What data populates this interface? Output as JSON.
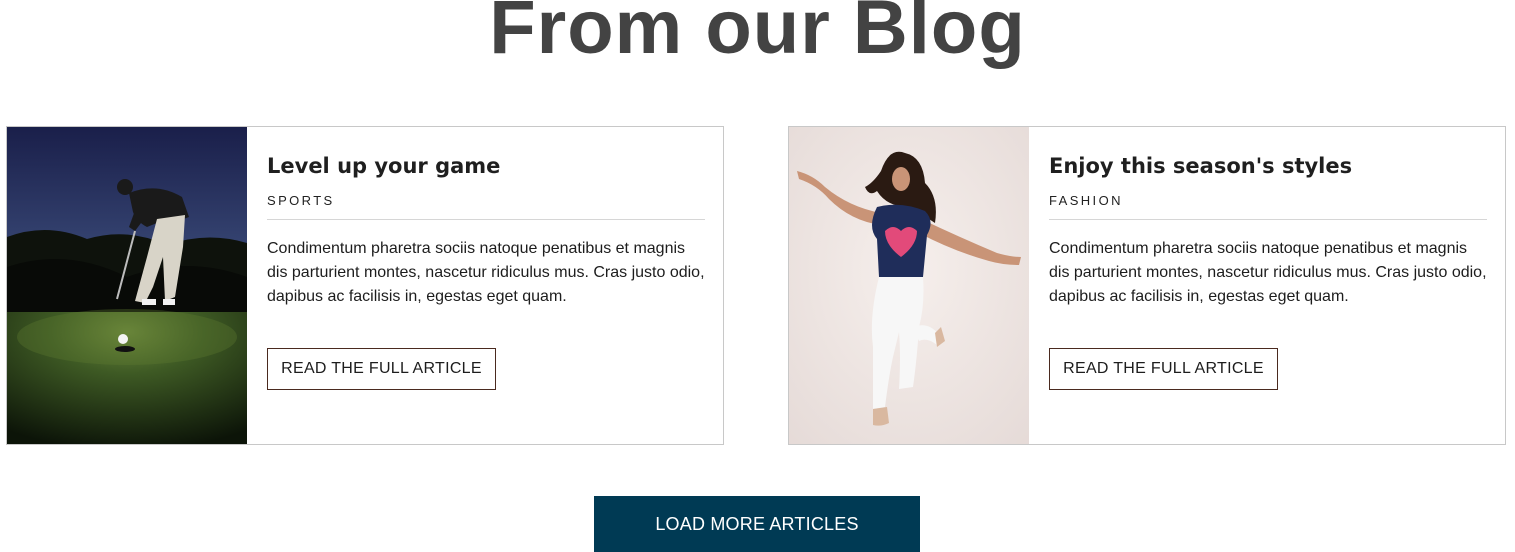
{
  "section": {
    "title": "From our Blog"
  },
  "articles": [
    {
      "title": "Level up your game",
      "category": "SPORTS",
      "excerpt": "Condimentum pharetra sociis natoque penatibus et magnis dis parturient montes, nascetur ridiculus mus. Cras justo odio, dapibus ac facilisis in, egestas eget quam.",
      "button_label": "READ THE FULL ARTICLE",
      "image": "golfer-putting-at-dusk-photo"
    },
    {
      "title": "Enjoy this season's styles",
      "category": "FASHION",
      "excerpt": "Condimentum pharetra sociis natoque penatibus et magnis dis parturient montes, nascetur ridiculus mus. Cras justo odio, dapibus ac facilisis in, egestas eget quam.",
      "button_label": "READ THE FULL ARTICLE",
      "image": "woman-dancing-fashion-photo"
    }
  ],
  "load_more": {
    "label": "LOAD MORE ARTICLES"
  },
  "colors": {
    "title_text": "#434343",
    "card_border": "#c8c8c8",
    "button_border": "#4a2a1f",
    "load_more_bg": "#003a54",
    "load_more_text": "#ffffff"
  }
}
